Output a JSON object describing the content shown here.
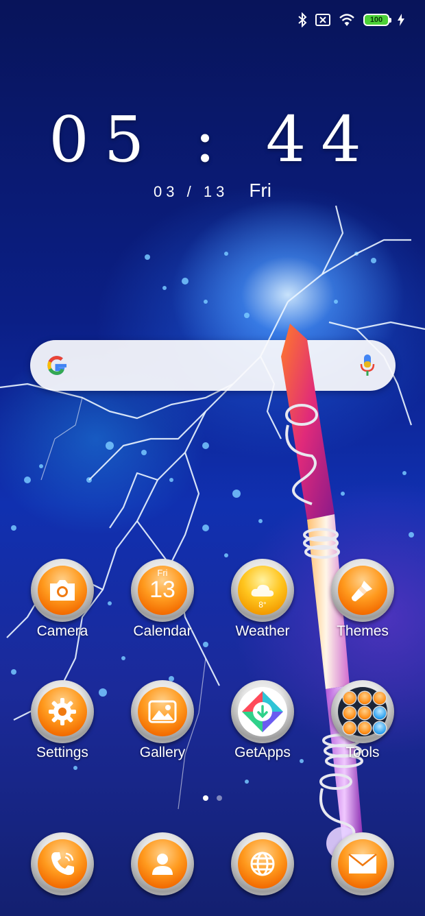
{
  "status_bar": {
    "icons": [
      "bluetooth-icon",
      "no-sim-icon",
      "wifi-icon",
      "battery-icon",
      "charging-icon"
    ],
    "battery_level": "100"
  },
  "clock": {
    "time": "05 : 44",
    "date": "03 / 13",
    "day": "Fri"
  },
  "search": {
    "logo": "google-g-icon",
    "voice": "microphone-icon"
  },
  "apps": [
    {
      "label": "Camera",
      "icon": "camera-icon"
    },
    {
      "label": "Calendar",
      "icon": "calendar-icon",
      "badge_day": "Fri",
      "badge_date": "13"
    },
    {
      "label": "Weather",
      "icon": "weather-icon",
      "temperature": "8°"
    },
    {
      "label": "Themes",
      "icon": "paintbrush-icon"
    },
    {
      "label": "Settings",
      "icon": "gear-icon"
    },
    {
      "label": "Gallery",
      "icon": "image-icon"
    },
    {
      "label": "GetApps",
      "icon": "getapps-icon"
    },
    {
      "label": "Tools",
      "icon": "folder-icon"
    }
  ],
  "dock": [
    {
      "icon": "phone-icon"
    },
    {
      "icon": "contacts-icon"
    },
    {
      "icon": "browser-globe-icon"
    },
    {
      "icon": "mail-icon"
    }
  ],
  "page_indicator": {
    "pages": 2,
    "current": 1
  },
  "colors": {
    "accent_orange": "#ff8a10",
    "battery_green": "#4cd137"
  }
}
